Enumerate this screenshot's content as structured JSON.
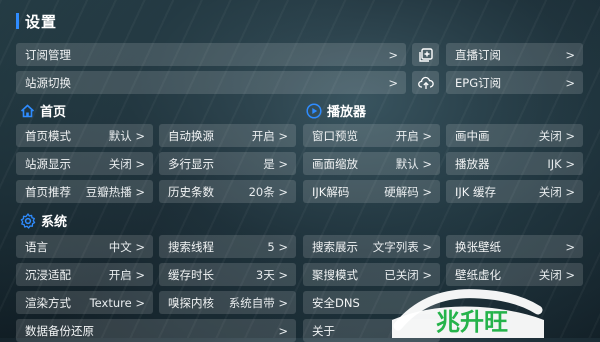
{
  "title": "设置",
  "top": {
    "subscription": {
      "label": "订阅管理",
      "arrow": ">"
    },
    "live": {
      "label": "直播订阅",
      "arrow": ">"
    },
    "source_switch": {
      "label": "站源切换",
      "arrow": ">"
    },
    "epg": {
      "label": "EPG订阅",
      "arrow": ">"
    }
  },
  "sections": {
    "home": {
      "title": "首页",
      "icon": "home-icon"
    },
    "player": {
      "title": "播放器",
      "icon": "play-circle-icon"
    },
    "system": {
      "title": "系统",
      "icon": "gear-icon"
    }
  },
  "home_items": [
    {
      "label": "首页模式",
      "value": "默认 >"
    },
    {
      "label": "自动换源",
      "value": "开启 >"
    },
    {
      "label": "站源显示",
      "value": "关闭 >"
    },
    {
      "label": "多行显示",
      "value": "是 >"
    },
    {
      "label": "首页推荐",
      "value": "豆瓣热播 >"
    },
    {
      "label": "历史条数",
      "value": "20条 >"
    }
  ],
  "player_items": [
    {
      "label": "窗口预览",
      "value": "开启 >"
    },
    {
      "label": "画中画",
      "value": "关闭 >"
    },
    {
      "label": "画面缩放",
      "value": "默认 >"
    },
    {
      "label": "播放器",
      "value": "IJK >"
    },
    {
      "label": "IJK解码",
      "value": "硬解码 >"
    },
    {
      "label": "IJK 缓存",
      "value": "关闭 >"
    }
  ],
  "system_items": [
    {
      "label": "语言",
      "value": "中文 >"
    },
    {
      "label": "搜索线程",
      "value": "5 >"
    },
    {
      "label": "搜索展示",
      "value": "文字列表 >"
    },
    {
      "label": "换张壁纸",
      "value": ">"
    },
    {
      "label": "沉浸适配",
      "value": "开启 >"
    },
    {
      "label": "缓存时长",
      "value": "3天 >"
    },
    {
      "label": "聚搜模式",
      "value": "已关闭 >"
    },
    {
      "label": "壁纸虚化",
      "value": "关闭 >"
    },
    {
      "label": "渲染方式",
      "value": "Texture >"
    },
    {
      "label": "嗅探内核",
      "value": "系统自带 >"
    },
    {
      "label": "安全DNS",
      "value": ""
    },
    {
      "label": "数据备份还原",
      "value": ">"
    },
    {
      "label": "关于",
      "value": ""
    }
  ],
  "watermark": {
    "text": "兆升旺"
  },
  "colors": {
    "accent": "#2f8cff",
    "tile": "rgba(255,255,255,0.14)"
  }
}
